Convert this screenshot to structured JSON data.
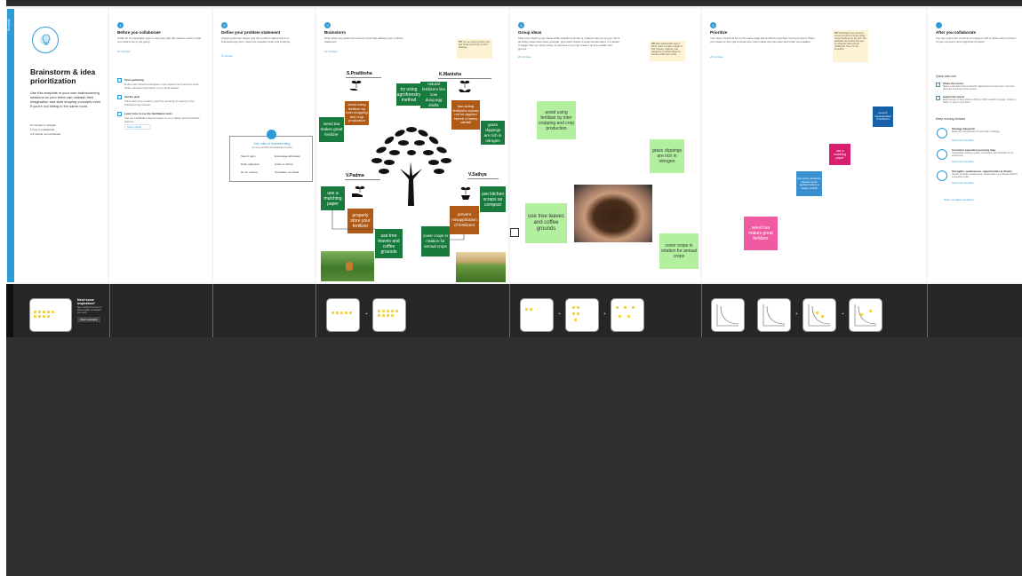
{
  "template": {
    "tab_label": "Template",
    "title": "Brainstorm & idea prioritization",
    "description": "Use this template in your own brainstorming sessions so your team can unleash their imagination and start shaping concepts even if you're not sitting in the same room.",
    "stats": [
      "10 minutes to prepare",
      "1 hour to collaborate",
      "2-8 people recommended"
    ],
    "inspiration_title": "Need some inspiration?",
    "inspiration_desc": "See a finished version of this template to kickstart your work.",
    "open_example": "Open example"
  },
  "before": {
    "num": "1",
    "title": "Before you collaborate",
    "desc": "A little bit of preparation goes a long way with this session. Here's what you need to do to get going.",
    "time": "10 minutes",
    "steps": [
      {
        "title": "Team gathering",
        "desc": "Define who should participate in the session and send an invite. Share relevant information or pre-work ahead."
      },
      {
        "title": "Set the goal",
        "desc": "Think about the problem you'll be focusing on solving in the brainstorming session."
      },
      {
        "title": "Learn how to use the facilitation tools",
        "desc": "Use the Facilitation Superpowers to run a happy and productive session."
      }
    ],
    "open_article": "Open article"
  },
  "define": {
    "num": "2",
    "title": "Define your problem statement",
    "desc": "Applying Herman Hesse and this problem statement for a brainstorming room. Keep the question short and inspiring.",
    "time": "5 minutes",
    "card_title": "Key rules of brainstorming",
    "card_sub": "To run an smooth and productive session",
    "rules": [
      "Stay in topic.",
      "Encourage wild ideas.",
      "Defer judgment.",
      "Listen to others.",
      "Go for volume.",
      "If possible, be visual."
    ]
  },
  "brainstorm": {
    "num": "3",
    "title": "Brainstorm",
    "desc": "Write down any ideas that come to mind that address your problem statement.",
    "time": "10 minutes",
    "tip": "You can select a sticky note and hit the pencil icon to start drawing!",
    "people": [
      "S.Pradiksha",
      "K.Manisha",
      "V.Padma",
      "V.Sathya"
    ],
    "notes": {
      "tip_tag": "TIP",
      "s1": "try using agroforestry method",
      "s2": "avoid using fertilizer by inter cropping and crop production",
      "s3": "weed tea makes great fertilizer",
      "k1": "natural fertilizers like cow dung,egg shells",
      "k2": "fast acting fertilizers should not be applied before a heavy rainfall",
      "k3": "grass clippings are rich in nitrogen",
      "p1": "use a mulching paper",
      "p2": "properly store your fertilizer",
      "p3": "use tree leaves and coffee grounds",
      "v1": "use kitchen scraps as compost",
      "v2": "prevent misapplication of fertilizers",
      "v3": "cover crops in rotation for annual crops"
    }
  },
  "group": {
    "num": "4",
    "title": "Group ideas",
    "desc": "Take turns sharing your ideas while clustering similar or related notes as you go. Once all sticky notes have been grouped, give each cluster a sentence-like label. If a cluster is bigger than six sticky notes, try and see if you can break it up into smaller sub-groups.",
    "time": "20 minutes",
    "tip": "Add customizable tags to sticky notes to make it easier to find, browse, organize, and categorize important ideas as themes within your mural.",
    "tip_tag": "TIP",
    "notes": [
      "avoid using fertilizer by inter cropping and crop production",
      "grass clippings are rich in nitrogen",
      "use tree leaves and coffee grounds",
      "cover crops in rotation for annual crops"
    ]
  },
  "prioritize": {
    "num": "5",
    "title": "Prioritize",
    "desc": "Your team should all be on the same page about what's important moving forward. Place your ideas on this grid to determine which ideas are important and which are feasible.",
    "time": "20 minutes",
    "tip": "Participants can use their cursors to point at where sticky notes should go on the grid. The facilitator can confirm the spot by using the laser pointer holding the H key on the keyboard.",
    "tip_tag": "TIP",
    "notes": [
      "prevent misapplication of fertilizers",
      "use a mulching paper",
      "fast acting fertilizers should not be applied before a heavy rainfall",
      "weed tea makes great fertilizer"
    ]
  },
  "after": {
    "title": "After you collaborate",
    "desc": "You can export the mural as an image or pdf to share with members of your company who might find it helpful.",
    "quick_add": "Quick add-ons",
    "share_title": "Share the mural",
    "share_desc": "Share a view link to the mural with stakeholders to keep them in the loop about the outcomes of the session.",
    "export_title": "Export the mural",
    "export_desc": "Export a copy of the mural as a PNG or PDF to attach to emails, include in slides, or save in your drive.",
    "keep_moving": "Keep moving forward",
    "items": [
      {
        "title": "Strategy blueprint",
        "desc": "Define the components of a new idea or strategy.",
        "link": "Open the template"
      },
      {
        "title": "Customer experience journey map",
        "desc": "Understand customer needs, motivations, and obstacles for an experience.",
        "link": "Open the template"
      },
      {
        "title": "Strengths, weaknesses, opportunities & threats",
        "desc": "Identify strengths, weaknesses, opportunities, and threats (SWOT) to develop a plan.",
        "link": "Open the template"
      }
    ],
    "feedback": "Share template feedback"
  }
}
